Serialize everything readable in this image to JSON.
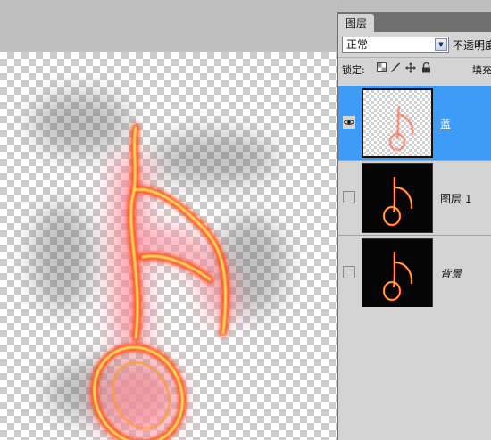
{
  "panel": {
    "tab_label": "图层",
    "blend_mode": "正常",
    "opacity_label": "不透明度",
    "lock_label": "锁定:",
    "fill_label": "填充"
  },
  "layers": [
    {
      "name": "蓝",
      "selected": true,
      "visible": true
    },
    {
      "name": "图层 1",
      "selected": false,
      "visible": false
    },
    {
      "name": "背景",
      "selected": false,
      "visible": false
    }
  ],
  "icons": {
    "dropdown": "chevron-down-icon",
    "lock_transparent": "checkerboard-lock-icon",
    "lock_paint": "brush-lock-icon",
    "lock_move": "move-lock-icon",
    "lock_all": "padlock-icon",
    "eye": "eye-icon"
  },
  "colors": {
    "selection": "#3d9cf7",
    "flame_core": "#ffdf5a",
    "flame_outer": "#ff4a1a"
  }
}
